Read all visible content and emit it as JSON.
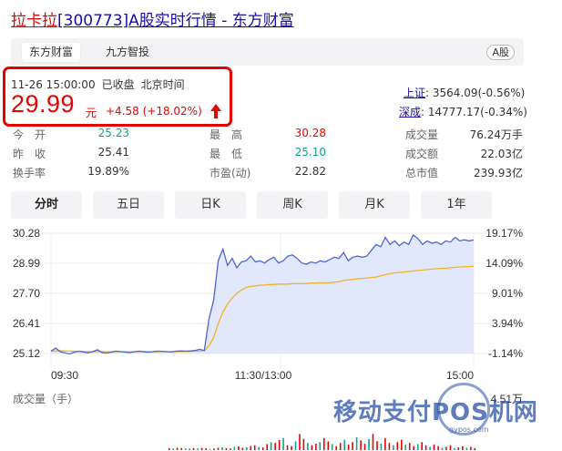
{
  "title": {
    "name": "拉卡拉",
    "code": "[300773]",
    "suffix": "A股实时行情 - 东方财富"
  },
  "source_tabs": [
    {
      "label": "东方财富",
      "active": true
    },
    {
      "label": "九方智投",
      "active": false
    }
  ],
  "market_badge": "A股",
  "quote": {
    "time": "11-26 15:00:00",
    "status": "已收盘",
    "timezone": "北京时间",
    "price": "29.99",
    "unit": "元",
    "change": "+4.58 (+18.02%)",
    "up_color": "#e10602",
    "down_color": "#12a38a",
    "arrow_icon": "up-arrow-icon"
  },
  "indices": [
    {
      "label": "上证",
      "value": ":  3564.09(-0.56%)"
    },
    {
      "label": "深成",
      "value": ":  14777.17(-0.34%)"
    }
  ],
  "stats": [
    {
      "label": "今　开",
      "value": "25.23",
      "tone": "green"
    },
    {
      "label": "最　高",
      "value": "30.28",
      "tone": "red"
    },
    {
      "label": "成交量",
      "value": "76.24万手",
      "tone": "dark"
    },
    {
      "label": "昨　收",
      "value": "25.41",
      "tone": "dark"
    },
    {
      "label": "最　低",
      "value": "25.10",
      "tone": "green"
    },
    {
      "label": "成交额",
      "value": "22.03亿",
      "tone": "dark"
    },
    {
      "label": "换手率",
      "value": "19.89%",
      "tone": "dark"
    },
    {
      "label": "市盈(动)",
      "value": "22.82",
      "tone": "dark"
    },
    {
      "label": "总市值",
      "value": "239.93亿",
      "tone": "dark"
    }
  ],
  "range_tabs": [
    {
      "label": "分时",
      "active": true
    },
    {
      "label": "五日",
      "active": false
    },
    {
      "label": "日K",
      "active": false
    },
    {
      "label": "周K",
      "active": false
    },
    {
      "label": "月K",
      "active": false
    },
    {
      "label": "1年",
      "active": false
    }
  ],
  "chart_data": {
    "type": "line",
    "title": "",
    "y_ticks_left": [
      "30.28",
      "28.99",
      "27.70",
      "26.41",
      "25.12"
    ],
    "y_ticks_right": [
      "19.17%",
      "14.09%",
      "9.01%",
      "3.94%",
      "-1.14%"
    ],
    "x_ticks": [
      "09:30",
      "11:30/13:00",
      "15:00"
    ],
    "ylim": [
      25.12,
      30.28
    ],
    "series": [
      {
        "values": [
          25.22,
          25.35,
          25.2,
          25.15,
          25.1,
          25.18,
          25.22,
          25.18,
          25.15,
          25.2,
          25.28,
          25.16,
          25.14,
          25.18,
          25.22,
          25.2,
          25.18,
          25.16,
          25.2,
          25.22,
          25.19,
          25.18,
          25.2,
          25.22,
          25.21,
          25.2,
          25.19,
          25.22,
          25.23,
          25.22,
          25.23,
          25.25,
          25.3,
          25.25,
          26.6,
          27.4,
          29.1,
          29.6,
          28.9,
          29.2,
          28.8,
          29.05,
          29.1,
          29.3,
          29.05,
          29.1,
          29.0,
          29.15,
          29.25,
          29.0,
          29.1,
          29.3,
          29.35,
          29.2,
          29.0,
          28.95,
          29.05,
          29.0,
          29.1,
          29.05,
          29.15,
          29.25,
          29.2,
          29.45,
          29.1,
          29.25,
          29.3,
          29.25,
          29.3,
          29.55,
          29.8,
          29.7,
          30.1,
          29.8,
          29.95,
          29.75,
          29.9,
          29.8,
          30.2,
          30.05,
          29.8,
          29.95,
          29.85,
          29.9,
          29.8,
          29.95,
          29.9,
          30.1,
          29.95,
          30.0,
          29.95,
          29.99
        ]
      },
      {
        "values": [
          25.22,
          25.23,
          25.24,
          25.23,
          25.22,
          25.22,
          25.21,
          25.21,
          25.2,
          25.2,
          25.2,
          25.2,
          25.2,
          25.2,
          25.2,
          25.2,
          25.2,
          25.2,
          25.2,
          25.2,
          25.2,
          25.2,
          25.2,
          25.2,
          25.2,
          25.2,
          25.2,
          25.2,
          25.21,
          25.21,
          25.21,
          25.22,
          25.22,
          25.24,
          25.45,
          25.8,
          26.4,
          26.9,
          27.25,
          27.5,
          27.7,
          27.85,
          27.95,
          28.0,
          28.02,
          28.05,
          28.05,
          28.08,
          28.08,
          28.1,
          28.1,
          28.1,
          28.12,
          28.12,
          28.12,
          28.12,
          28.14,
          28.14,
          28.15,
          28.15,
          28.16,
          28.18,
          28.2,
          28.25,
          28.28,
          28.3,
          28.32,
          28.34,
          28.36,
          28.38,
          28.4,
          28.45,
          28.5,
          28.55,
          28.58,
          28.6,
          28.62,
          28.64,
          28.66,
          28.68,
          28.7,
          28.72,
          28.74,
          28.76,
          28.77,
          28.78,
          28.8,
          28.82,
          28.83,
          28.84,
          28.85,
          28.86
        ]
      }
    ],
    "line_color": "#4e67d0",
    "avg_color": "#f0b428",
    "fill_color": "#dfe6fb",
    "volume_label": "成交量（手）",
    "volume_max_label": "4.51万",
    "volume": [
      0.05,
      0.04,
      0.06,
      0.05,
      0.04,
      0.03,
      0.05,
      0.04,
      0.06,
      0.05,
      0.03,
      0.04,
      0.06,
      0.07,
      0.05,
      0.04,
      0.08,
      0.09,
      0.06,
      0.07,
      0.1,
      0.12,
      0.08,
      0.07,
      0.15,
      0.2,
      0.18,
      0.25,
      0.3,
      0.12,
      0.1,
      0.22,
      0.4,
      0.28,
      0.18,
      0.12,
      0.16,
      0.2,
      0.3,
      0.22,
      0.15,
      0.1,
      0.18,
      0.26,
      0.14,
      0.2,
      0.32,
      0.24,
      0.16,
      0.28,
      0.4,
      0.22,
      0.16,
      0.3,
      0.18,
      0.12,
      0.2,
      0.26,
      0.14,
      0.18,
      0.1,
      0.15,
      0.2,
      0.12,
      0.08,
      0.14,
      0.1,
      0.06,
      0.08,
      0.12,
      0.05,
      0.07,
      0.1,
      0.06,
      0.08,
      0.05
    ]
  },
  "watermark": {
    "text": "移动支付POS机网",
    "sub": "gypos.com"
  }
}
